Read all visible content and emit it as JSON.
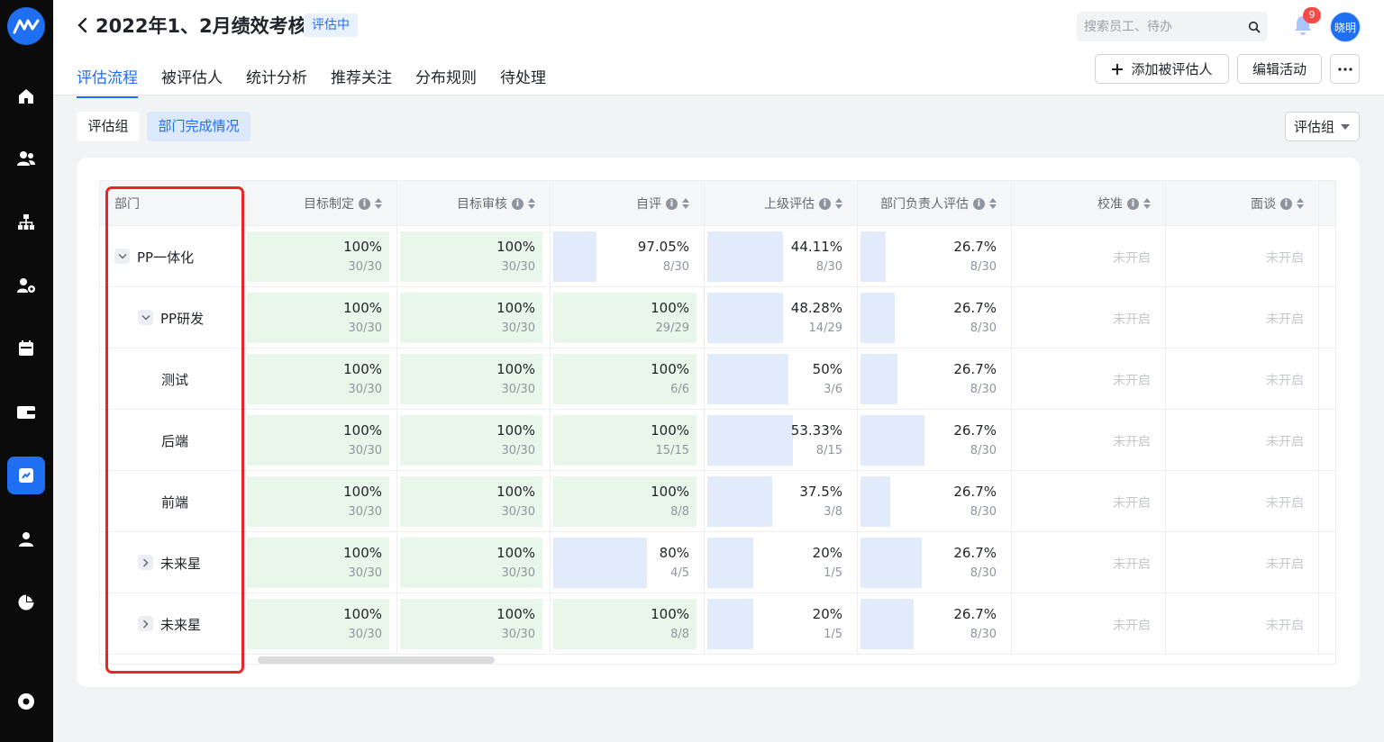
{
  "header": {
    "title": "2022年1、2月绩效考核",
    "status": "评估中",
    "search_placeholder": "搜索员工、待办",
    "notification_count": "9",
    "avatar_name": "晓明",
    "add_label": "添加被评估人",
    "edit_label": "编辑活动"
  },
  "tabs": [
    {
      "label": "评估流程",
      "active": true
    },
    {
      "label": "被评估人",
      "active": false
    },
    {
      "label": "统计分析",
      "active": false
    },
    {
      "label": "推荐关注",
      "active": false
    },
    {
      "label": "分布规则",
      "active": false
    },
    {
      "label": "待处理",
      "active": false
    }
  ],
  "toolbar": {
    "seg1": "评估组",
    "seg2": "部门完成情况",
    "dropdown": "评估组"
  },
  "table": {
    "dept_header": "部门",
    "columns": [
      "目标制定",
      "目标审核",
      "自评",
      "上级评估",
      "部门负责人评估",
      "校准",
      "面谈"
    ],
    "not_started": "未开启",
    "rows": [
      {
        "name": "PP一体化",
        "level": 0,
        "toggle": "expanded",
        "cells": [
          [
            "100%",
            "30/30",
            1.0
          ],
          [
            "100%",
            "30/30",
            1.0
          ],
          [
            "97.05%",
            "8/30",
            0.29
          ],
          [
            "44.11%",
            "8/30",
            0.51
          ],
          [
            "26.7%",
            "8/30",
            0.17
          ]
        ]
      },
      {
        "name": "PP研发",
        "level": 1,
        "toggle": "expanded",
        "cells": [
          [
            "100%",
            "30/30",
            1.0
          ],
          [
            "100%",
            "30/30",
            1.0
          ],
          [
            "100%",
            "29/29",
            1.0
          ],
          [
            "48.28%",
            "14/29",
            0.51
          ],
          [
            "26.7%",
            "8/30",
            0.23
          ]
        ]
      },
      {
        "name": "测试",
        "level": 2,
        "toggle": "none",
        "cells": [
          [
            "100%",
            "30/30",
            1.0
          ],
          [
            "100%",
            "30/30",
            1.0
          ],
          [
            "100%",
            "6/6",
            1.0
          ],
          [
            "50%",
            "3/6",
            0.55
          ],
          [
            "26.7%",
            "8/30",
            0.25
          ]
        ]
      },
      {
        "name": "后端",
        "level": 2,
        "toggle": "none",
        "cells": [
          [
            "100%",
            "30/30",
            1.0
          ],
          [
            "100%",
            "30/30",
            1.0
          ],
          [
            "100%",
            "15/15",
            1.0
          ],
          [
            "53.33%",
            "8/15",
            0.58
          ],
          [
            "26.7%",
            "8/30",
            0.43
          ]
        ]
      },
      {
        "name": "前端",
        "level": 2,
        "toggle": "none",
        "cells": [
          [
            "100%",
            "30/30",
            1.0
          ],
          [
            "100%",
            "30/30",
            1.0
          ],
          [
            "100%",
            "8/8",
            1.0
          ],
          [
            "37.5%",
            "3/8",
            0.44
          ],
          [
            "26.7%",
            "8/30",
            0.2
          ]
        ]
      },
      {
        "name": "未来星",
        "level": 1,
        "toggle": "collapsed",
        "cells": [
          [
            "100%",
            "30/30",
            1.0
          ],
          [
            "100%",
            "30/30",
            1.0
          ],
          [
            "80%",
            "4/5",
            0.63
          ],
          [
            "20%",
            "1/5",
            0.31
          ],
          [
            "26.7%",
            "8/30",
            0.41
          ]
        ]
      },
      {
        "name": "未来星",
        "level": 1,
        "toggle": "collapsed",
        "cells": [
          [
            "100%",
            "30/30",
            1.0
          ],
          [
            "100%",
            "30/30",
            1.0
          ],
          [
            "100%",
            "8/8",
            1.0
          ],
          [
            "20%",
            "1/5",
            0.31
          ],
          [
            "26.7%",
            "8/30",
            0.36
          ]
        ]
      }
    ]
  },
  "colors": {
    "accent": "#1f6ff2",
    "green_fill": "#e8f7ea",
    "blue_fill": "#e1ebfc",
    "highlight": "#e8262a"
  }
}
